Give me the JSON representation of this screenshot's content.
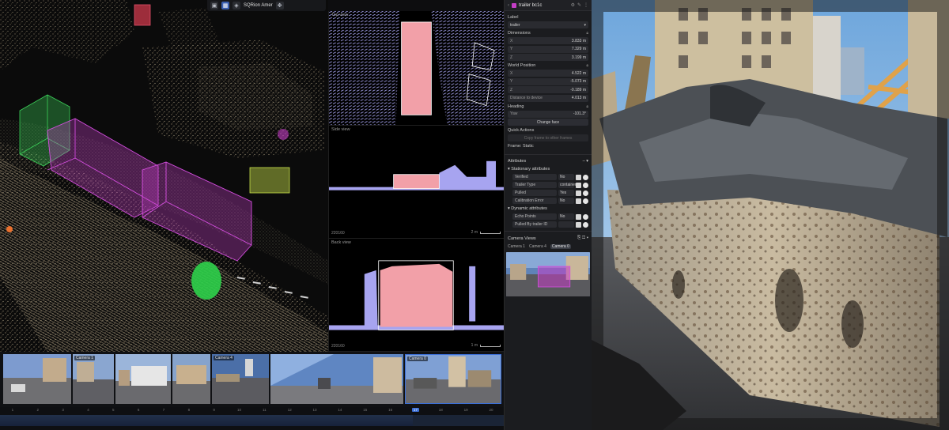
{
  "viewport": {
    "toolbar": {
      "label": "SQRion Amer",
      "icons": [
        "camera-icon",
        "grid-icon",
        "layers-icon",
        "move-icon"
      ]
    }
  },
  "ortho": {
    "top": {
      "title": "Top view",
      "scale": "",
      "id": ""
    },
    "side": {
      "title": "Side view",
      "scale": "2 m",
      "id": "220160"
    },
    "back": {
      "title": "Back view",
      "scale": "1 m",
      "id": "220160"
    }
  },
  "panel": {
    "title": "trailer bc1c",
    "label_section": "Label",
    "label_value": "trailer",
    "dimensions_section": "Dimensions",
    "dimensions": [
      {
        "k": "X",
        "v": "3.833 m"
      },
      {
        "k": "Y",
        "v": "7.329 m"
      },
      {
        "k": "Z",
        "v": "3.199 m"
      }
    ],
    "world_section": "World Position",
    "world": [
      {
        "k": "X",
        "v": "4.522 m"
      },
      {
        "k": "Y",
        "v": "-5.073 m"
      },
      {
        "k": "Z",
        "v": "-0.189 m"
      }
    ],
    "distance": {
      "k": "Distance to device",
      "v": "4.013 m"
    },
    "heading_section": "Heading",
    "heading": {
      "k": "Yaw",
      "v": "-101.3°"
    },
    "change_face": "Change face",
    "quick_actions": "Quick Actions",
    "quick_action_btn": "Copy frame to other frames",
    "frame_status": "Frame: Static",
    "attributes": "Attributes",
    "stationary_attributes": "Stationary attributes",
    "stationary": [
      {
        "name": "Verified",
        "value": "No"
      },
      {
        "name": "Trailer Type",
        "value": "container"
      },
      {
        "name": "Pulled",
        "value": "Yes"
      },
      {
        "name": "Calibration Error",
        "value": "No"
      }
    ],
    "dynamic_attributes": "Dynamic attributes",
    "dynamic": [
      {
        "name": "Echo Points",
        "value": "No"
      },
      {
        "name": "Pulled By trailer ID",
        "value": ""
      }
    ],
    "camera_views": "Camera Views",
    "camera_tabs": [
      "Camera 1",
      "Camera 4",
      "Camera 0"
    ],
    "active_camera": "Camera 0"
  },
  "camstrip": {
    "cells": [
      {
        "label": ""
      },
      {
        "label": "Camera 1"
      },
      {
        "label": ""
      },
      {
        "label": ""
      },
      {
        "label": "Camera 4"
      },
      {
        "label": ""
      },
      {
        "label": "Camera 0"
      }
    ]
  },
  "timeline": {
    "ticks": [
      "1",
      "2",
      "3",
      "4",
      "5",
      "6",
      "7",
      "8",
      "9",
      "10",
      "11",
      "12",
      "13",
      "14",
      "15",
      "16",
      "17",
      "18",
      "19",
      "20"
    ],
    "active": "17"
  },
  "colors": {
    "accent": "#3c6fd6",
    "selected_box": "#c43ec7",
    "top_view_points": "#a7a4f0",
    "selected_points": "#f2a0a8",
    "green_box": "#3cd25a",
    "yellow_box": "#c8e04a"
  }
}
